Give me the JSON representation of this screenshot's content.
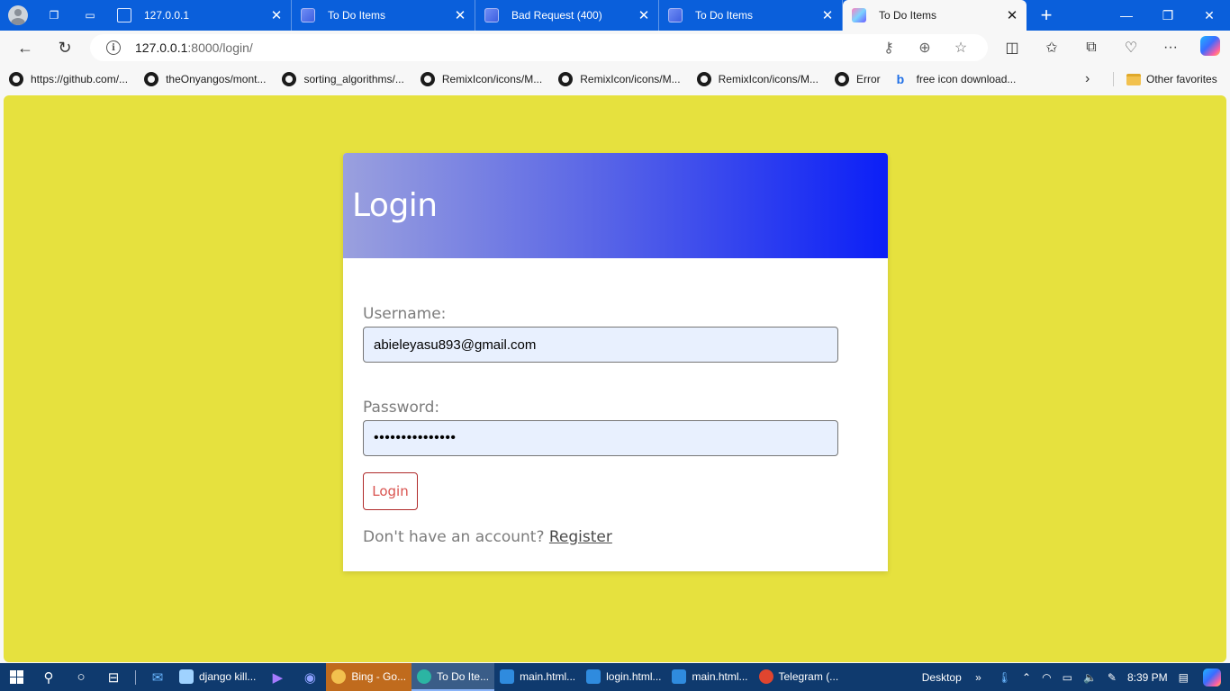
{
  "browser": {
    "tabs": [
      {
        "title": "127.0.0.1",
        "active": false
      },
      {
        "title": "To Do Items",
        "active": false
      },
      {
        "title": "Bad Request (400)",
        "active": false
      },
      {
        "title": "To Do Items",
        "active": false
      },
      {
        "title": "To Do Items",
        "active": true
      }
    ],
    "url_host": "127.0.0.1",
    "url_path": ":8000/login/",
    "bookmarks": [
      {
        "label": "https://github.com/...",
        "icon": "github-icon"
      },
      {
        "label": "theOnyangos/mont...",
        "icon": "github-icon"
      },
      {
        "label": "sorting_algorithms/...",
        "icon": "github-icon"
      },
      {
        "label": "RemixIcon/icons/M...",
        "icon": "github-icon"
      },
      {
        "label": "RemixIcon/icons/M...",
        "icon": "github-icon"
      },
      {
        "label": "RemixIcon/icons/M...",
        "icon": "github-icon"
      },
      {
        "label": "Error",
        "icon": "github-icon"
      },
      {
        "label": "free icon download...",
        "icon": "bing-icon"
      }
    ],
    "other_favorites": "Other favorites"
  },
  "page": {
    "background": "#e6e13e",
    "header_gradient": [
      "#9aa0de",
      "#0b1ff7"
    ],
    "title": "Login",
    "username_label": "Username:",
    "username_value": "abieleyasu893@gmail.com",
    "password_label": "Password:",
    "password_value": "•••••••••••••••",
    "login_button": "Login",
    "footer_text": "Don't have an account?",
    "register_link": "Register"
  },
  "taskbar": {
    "apps": [
      {
        "label": "django kill...",
        "icon": "notepad-icon",
        "state": "normal"
      },
      {
        "label": "Bing - Go...",
        "icon": "chrome-icon",
        "state": "selected"
      },
      {
        "label": "To Do Ite...",
        "icon": "edge-icon",
        "state": "active"
      },
      {
        "label": "main.html...",
        "icon": "vscode-icon",
        "state": "normal"
      },
      {
        "label": "login.html...",
        "icon": "vscode-icon",
        "state": "normal"
      },
      {
        "label": "main.html...",
        "icon": "vscode-icon",
        "state": "normal"
      },
      {
        "label": "Telegram (...",
        "icon": "telegram-icon",
        "state": "normal"
      }
    ],
    "desktop_label": "Desktop",
    "time": "8:39 PM"
  }
}
